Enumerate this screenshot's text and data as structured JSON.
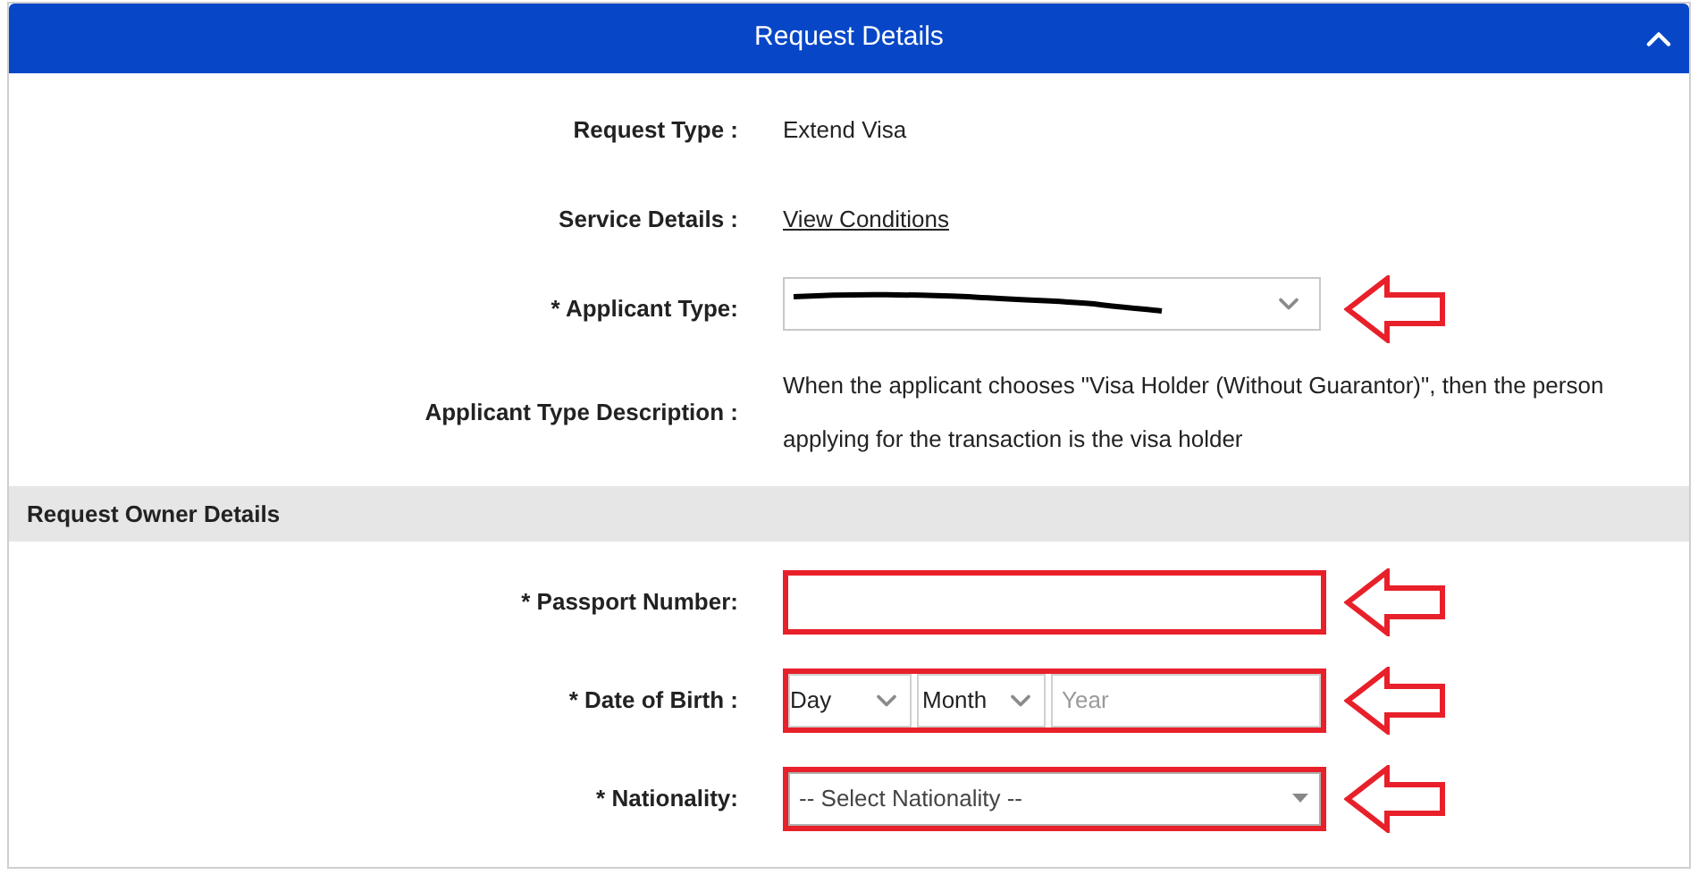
{
  "panel": {
    "title": "Request Details",
    "expanded": true
  },
  "details": [
    {
      "kind": "text",
      "label": "Request Type :",
      "value": "Extend Visa"
    },
    {
      "kind": "link",
      "label": "Service Details :",
      "value": "View Conditions"
    },
    {
      "kind": "select",
      "label": "* Applicant Type:",
      "redacted": true,
      "highlighted": false,
      "pointed_at": true
    },
    {
      "kind": "text",
      "label": "Applicant Type Description :",
      "value": "When the applicant chooses \"Visa Holder (Without Guarantor)\", then the person applying for the transaction is the visa holder"
    }
  ],
  "section": {
    "title": "Request Owner Details"
  },
  "owner_fields": [
    {
      "kind": "input",
      "label": "* Passport Number:",
      "highlighted": true,
      "pointed_at": true
    },
    {
      "kind": "date",
      "label": "* Date of Birth :",
      "day": "Day",
      "month": "Month",
      "year_placeholder": "Year",
      "highlighted": true,
      "pointed_at": true
    },
    {
      "kind": "dropdown",
      "label": "* Nationality:",
      "value": "-- Select Nationality --",
      "highlighted": true,
      "pointed_at": true
    }
  ]
}
